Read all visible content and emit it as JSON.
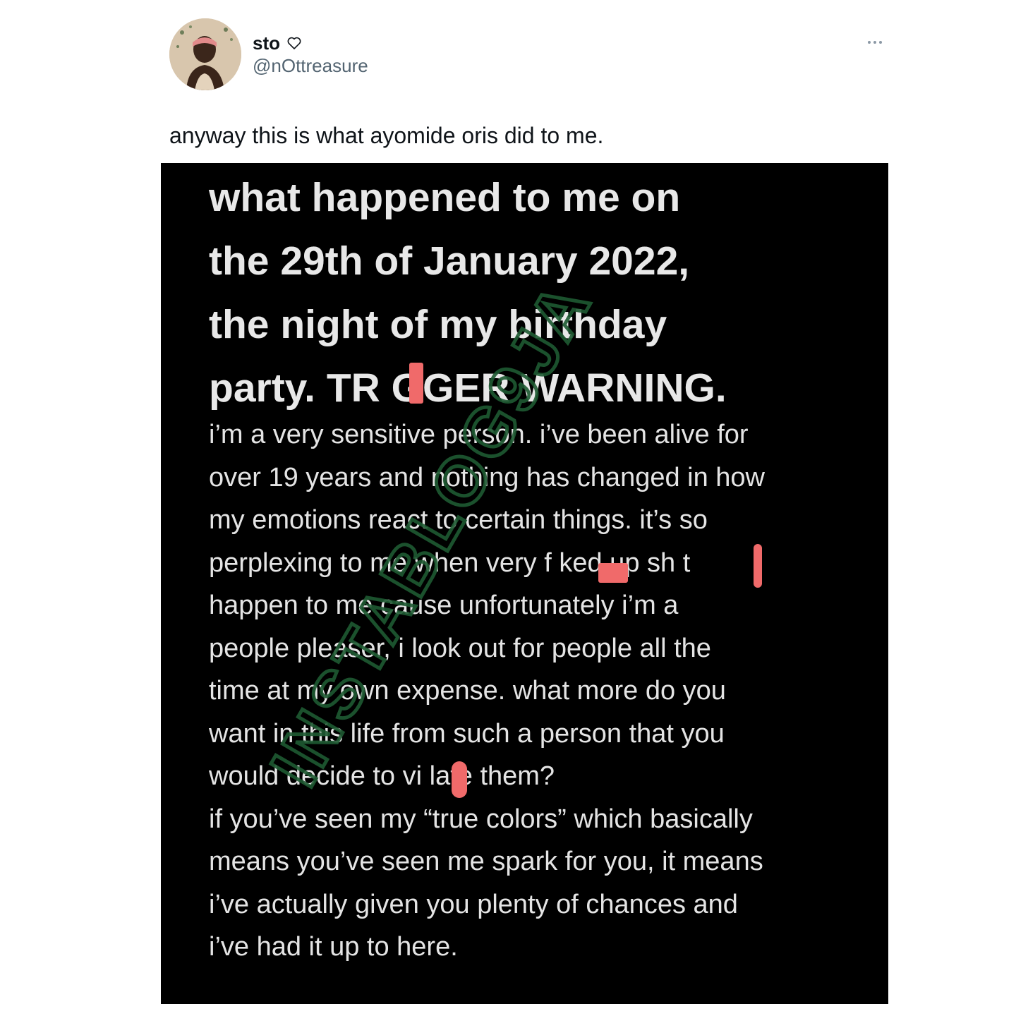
{
  "tweet": {
    "author": {
      "display_name": "sto",
      "handle": "@nOttreasure",
      "avatar_icon": "profile-photo",
      "name_suffix_icon": "heart-outline-icon"
    },
    "menu_icon": "more-dots-icon",
    "text": "anyway this is what ayomide oris did to me."
  },
  "image": {
    "headline_lines": [
      "what happened to me on",
      "the 29th of January 2022,",
      "the night of my birthday",
      "party. TR GGER WARNING."
    ],
    "body_lines": [
      "i’m a very sensitive person. i’ve been alive for",
      "over 19 years and nothing has changed in how",
      "my emotions react to certain things. it’s so",
      "perplexing to me when very f  ked up sh t",
      "happen to me cause unfortunately i’m a",
      "people pleaser, i look out for people all the",
      "time at my own expense. what more do you",
      "want in this life from such a person that you",
      "would decide to vi late them?",
      "if you’ve seen my “true colors” which basically",
      "means you’ve seen me spark for you, it means",
      "i’ve actually given you plenty of chances and",
      "i’ve had it up to here."
    ],
    "watermark": "INSTABLOG9JA",
    "redaction_color": "#f06a6a",
    "watermark_color": "#1e5a32"
  }
}
